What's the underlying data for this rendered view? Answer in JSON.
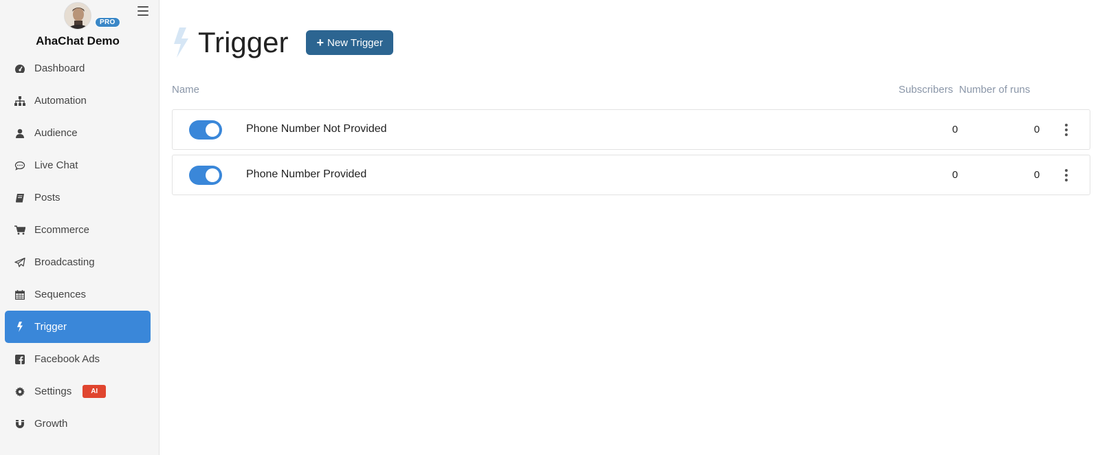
{
  "sidebar": {
    "app_name": "AhaChat Demo",
    "badge": "PRO",
    "items": [
      {
        "label": "Dashboard",
        "icon": "dashboard-icon"
      },
      {
        "label": "Automation",
        "icon": "sitemap-icon"
      },
      {
        "label": "Audience",
        "icon": "user-icon"
      },
      {
        "label": "Live Chat",
        "icon": "chat-icon"
      },
      {
        "label": "Posts",
        "icon": "book-icon"
      },
      {
        "label": "Ecommerce",
        "icon": "cart-icon"
      },
      {
        "label": "Broadcasting",
        "icon": "paper-plane-icon"
      },
      {
        "label": "Sequences",
        "icon": "calendar-icon"
      },
      {
        "label": "Trigger",
        "icon": "bolt-icon",
        "active": true
      },
      {
        "label": "Facebook Ads",
        "icon": "facebook-icon"
      },
      {
        "label": "Settings",
        "icon": "gear-icon",
        "badge": "AI"
      },
      {
        "label": "Growth",
        "icon": "magnet-icon"
      }
    ]
  },
  "header": {
    "title": "Trigger",
    "new_button_label": "New Trigger"
  },
  "table": {
    "columns": {
      "name": "Name",
      "subscribers": "Subscribers",
      "runs": "Number of runs"
    },
    "rows": [
      {
        "name": "Phone Number Not Provided",
        "enabled": true,
        "subscribers": "0",
        "runs": "0"
      },
      {
        "name": "Phone Number Provided",
        "enabled": true,
        "subscribers": "0",
        "runs": "0"
      }
    ]
  },
  "colors": {
    "accent": "#3a87d9",
    "button": "#2c6591",
    "ai_badge": "#e0452f",
    "pro_badge": "#3a87c7"
  }
}
